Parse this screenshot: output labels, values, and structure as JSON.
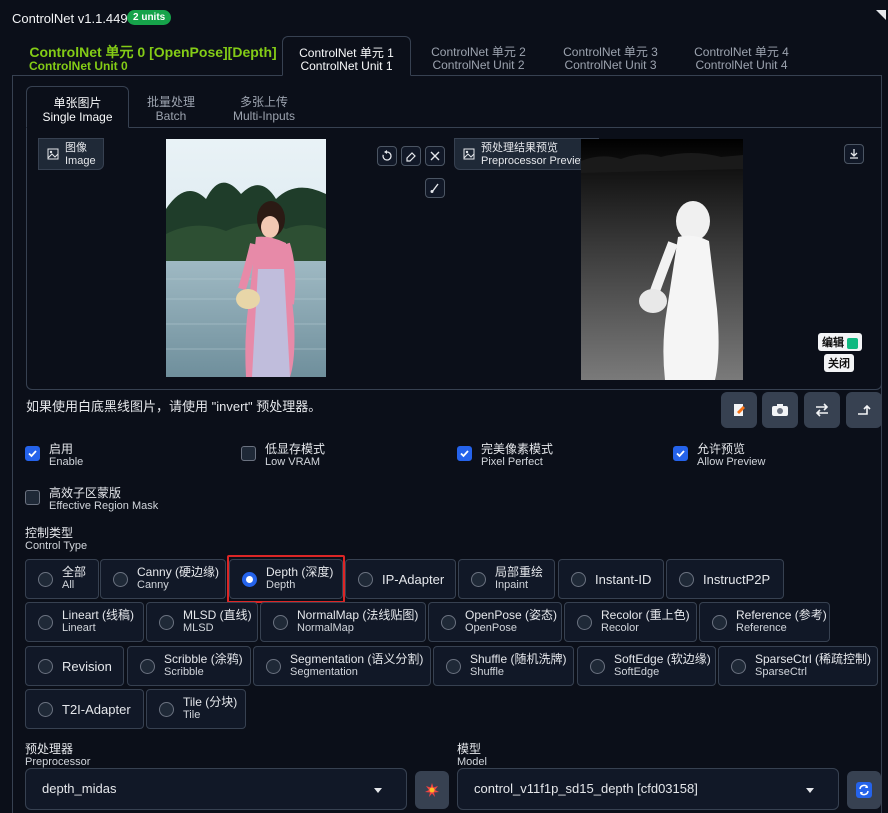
{
  "header": {
    "title": "ControlNet v1.1.449",
    "badge": "2 units"
  },
  "unit_tabs": [
    {
      "l1": "ControlNet 单元 0 [OpenPose][Depth]",
      "l2": "ControlNet Unit 0"
    },
    {
      "l1": "ControlNet 单元 1",
      "l2": "ControlNet Unit 1"
    },
    {
      "l1": "ControlNet 单元 2",
      "l2": "ControlNet Unit 2"
    },
    {
      "l1": "ControlNet 单元 3",
      "l2": "ControlNet Unit 3"
    },
    {
      "l1": "ControlNet 单元 4",
      "l2": "ControlNet Unit 4"
    }
  ],
  "input_tabs": [
    {
      "l1": "单张图片",
      "l2": "Single Image"
    },
    {
      "l1": "批量处理",
      "l2": "Batch"
    },
    {
      "l1": "多张上传",
      "l2": "Multi-Inputs"
    }
  ],
  "image_label": {
    "l1": "图像",
    "l2": "Image"
  },
  "preview_label": {
    "l1": "预处理结果预览",
    "l2": "Preprocessor Preview"
  },
  "preview_tags": {
    "edit": "编辑",
    "close": "关闭"
  },
  "hint": "如果使用白底黑线图片，请使用 \"invert\" 预处理器。",
  "checkboxes": [
    {
      "l1": "启用",
      "l2": "Enable",
      "checked": true
    },
    {
      "l1": "低显存模式",
      "l2": "Low VRAM",
      "checked": false
    },
    {
      "l1": "完美像素模式",
      "l2": "Pixel Perfect",
      "checked": true
    },
    {
      "l1": "允许预览",
      "l2": "Allow Preview",
      "checked": true
    },
    {
      "l1": "高效子区蒙版",
      "l2": "Effective Region Mask",
      "checked": false
    }
  ],
  "control_type": {
    "l1": "控制类型",
    "l2": "Control Type"
  },
  "control_types": [
    {
      "l1": "全部",
      "l2": "All"
    },
    {
      "l1": "Canny (硬边缘)",
      "l2": "Canny"
    },
    {
      "l1": "Depth (深度)",
      "l2": "Depth"
    },
    {
      "l1": "IP-Adapter",
      "l2": ""
    },
    {
      "l1": "局部重绘",
      "l2": "Inpaint"
    },
    {
      "l1": "Instant-ID",
      "l2": ""
    },
    {
      "l1": "InstructP2P",
      "l2": ""
    },
    {
      "l1": "Lineart (线稿)",
      "l2": "Lineart"
    },
    {
      "l1": "MLSD (直线)",
      "l2": "MLSD"
    },
    {
      "l1": "NormalMap (法线贴图)",
      "l2": "NormalMap"
    },
    {
      "l1": "OpenPose (姿态)",
      "l2": "OpenPose"
    },
    {
      "l1": "Recolor (重上色)",
      "l2": "Recolor"
    },
    {
      "l1": "Reference (参考)",
      "l2": "Reference"
    },
    {
      "l1": "Revision",
      "l2": ""
    },
    {
      "l1": "Scribble (涂鸦)",
      "l2": "Scribble"
    },
    {
      "l1": "Segmentation (语义分割)",
      "l2": "Segmentation"
    },
    {
      "l1": "Shuffle (随机洗牌)",
      "l2": "Shuffle"
    },
    {
      "l1": "SoftEdge (软边缘)",
      "l2": "SoftEdge"
    },
    {
      "l1": "SparseCtrl (稀疏控制)",
      "l2": "SparseCtrl"
    },
    {
      "l1": "T2I-Adapter",
      "l2": ""
    },
    {
      "l1": "Tile (分块)",
      "l2": "Tile"
    }
  ],
  "selected_control_type": "Depth (深度)",
  "preprocessor": {
    "l1": "预处理器",
    "l2": "Preprocessor",
    "value": "depth_midas"
  },
  "model": {
    "l1": "模型",
    "l2": "Model",
    "value": "control_v11f1p_sd15_depth [cfd03158]"
  },
  "colors": {
    "accent": "#2563eb",
    "unit0": "#84cc16",
    "badge": "#16a34a",
    "highlight": "#dc2626",
    "refresh": "#2563eb",
    "run": "#374151"
  }
}
